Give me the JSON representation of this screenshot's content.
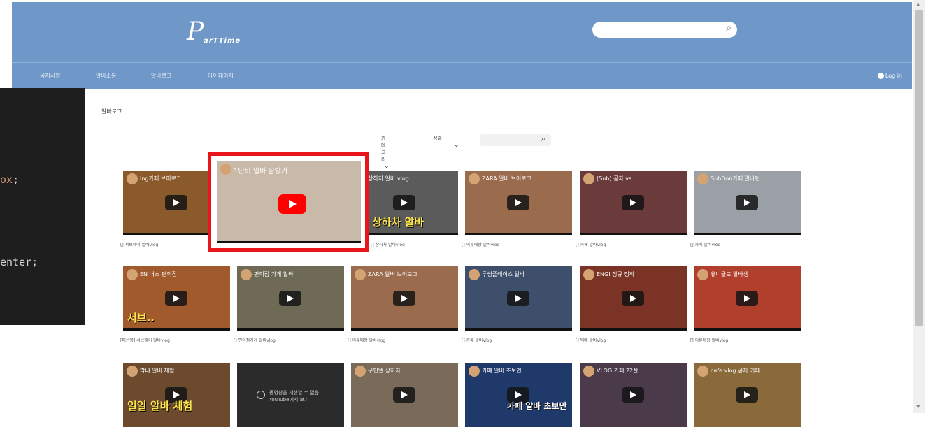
{
  "header": {
    "logo_letter": "P",
    "logo_text": "arTTime",
    "search_placeholder": "",
    "nav": [
      "공지사항",
      "알바소통",
      "알바로그",
      "마이페이지"
    ],
    "login_label": "Log in"
  },
  "code_panel": {
    "lines": [
      "ox;",
      "enter;"
    ],
    "colors": {
      "ox": "#ce9178",
      "semicolon": "#d4d4d4",
      "enter": "#d4d4d4"
    }
  },
  "page_title": "알바로그",
  "filters": {
    "category_label": "카테고리",
    "sort_label": "정렬",
    "search_value": ""
  },
  "videos": {
    "row1": [
      {
        "title": "Ing카페 브이로그",
        "caption": "[] 서브웨이 알바vlog",
        "thumb_color": "#8a5a2b",
        "overlay": ""
      },
      {
        "title": "1단비 알바 탐방기",
        "caption": "",
        "thumb_color": "#c9b9a8",
        "overlay": ""
      },
      {
        "title": "상하차 알바 vlog",
        "caption": "[] 상하차 알바vlog",
        "thumb_color": "#5b5b5b",
        "overlay": "상하차 알바"
      },
      {
        "title": "ZARA 알바 브이로그",
        "caption": "[] 의류매장 알바vlog",
        "thumb_color": "#9b6b4e",
        "overlay": ""
      },
      {
        "title": "(Sub) 공차 vs",
        "caption": "[] 카페 알바vlog",
        "thumb_color": "#6b3a3a",
        "overlay": ""
      },
      {
        "title": "SubDon카페 알바편",
        "caption": "[] 카페 알바vlog",
        "thumb_color": "#9aa0a6",
        "overlay": ""
      }
    ],
    "row2": [
      {
        "title": "EN 너스 편의점",
        "caption": "[퍼온영] 서브웨이 알바vlog",
        "thumb_color": "#a05a2c",
        "overlay": "서브.."
      },
      {
        "title": "편의점 가게 알바",
        "caption": "[] 편의점가게 알바vlog",
        "thumb_color": "#6e6a55",
        "overlay": ""
      },
      {
        "title": "ZARA 알바 브이로그",
        "caption": "[] 의류매장 알바vlog",
        "thumb_color": "#9b6b4e",
        "overlay": ""
      },
      {
        "title": "투썸플레이스 알바",
        "caption": "[] 카페 알바vlog",
        "thumb_color": "#3d4f6a",
        "overlay": ""
      },
      {
        "title": "ENGI 정규 정직",
        "caption": "[] 택배 알바vlog",
        "thumb_color": "#7a3324",
        "overlay": ""
      },
      {
        "title": "유니클로 알바생",
        "caption": "[] 의류매장 알바vlog",
        "thumb_color": "#b0402c",
        "overlay": ""
      }
    ],
    "row3": [
      {
        "title": "막내 알바 체험",
        "caption": "",
        "thumb_color": "#6b4a2e",
        "overlay": "일일 알바 체험"
      },
      {
        "title": "",
        "caption": "",
        "thumb_color": "#2b2b2b",
        "overlay": "",
        "unavailable": "동영상을 재생할 수 없음",
        "unavailable2": "YouTube에서 보기"
      },
      {
        "title": "무인텔 상하차",
        "caption": "",
        "thumb_color": "#7a6a5a",
        "overlay": ""
      },
      {
        "title": "카페 알바 초보면",
        "caption": "",
        "thumb_color": "#1f3a6a",
        "overlay": "카페 알바 초보만"
      },
      {
        "title": "VLOG 카페 22살",
        "caption": "",
        "thumb_color": "#4a3a4a",
        "overlay": ""
      },
      {
        "title": "cafe vlog 공차 카페",
        "caption": "",
        "thumb_color": "#8a6a3a",
        "overlay": ""
      }
    ]
  }
}
